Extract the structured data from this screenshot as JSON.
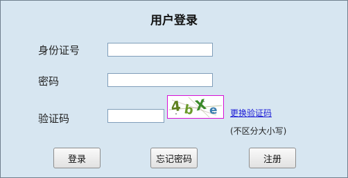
{
  "title": "用户登录",
  "labels": {
    "id_number": "身份证号",
    "password": "密码",
    "captcha": "验证码"
  },
  "fields": {
    "id_number": {
      "value": "",
      "placeholder": ""
    },
    "password": {
      "value": "",
      "placeholder": ""
    },
    "captcha": {
      "value": "",
      "placeholder": ""
    }
  },
  "captcha": {
    "chars": [
      "4",
      "b",
      "X",
      "e"
    ],
    "colors": [
      "#5f7f1e",
      "#6a9a2a",
      "#3b8a2a",
      "#3a7fb0"
    ],
    "refresh_label": "更换验证码",
    "case_hint": "(不区分大小写)"
  },
  "buttons": {
    "login": "登录",
    "forgot_password": "忘记密码",
    "register": "注册"
  }
}
